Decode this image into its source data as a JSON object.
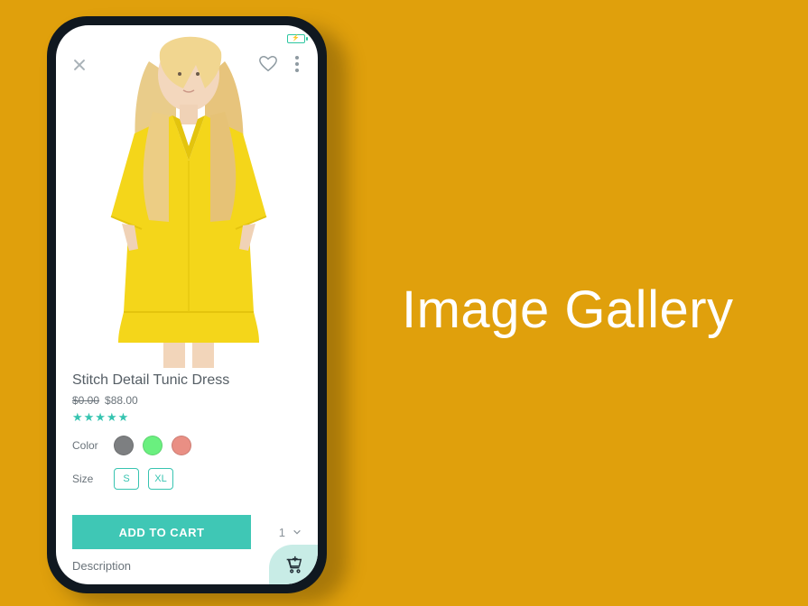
{
  "hero_title": "Image Gallery",
  "status": {
    "battery_icon": "battery-charging-icon"
  },
  "topbar": {
    "close_icon": "close-icon",
    "favorite_icon": "heart-icon",
    "more_icon": "more-vertical-icon"
  },
  "product": {
    "title": "Stitch Detail Tunic Dress",
    "price_old": "$0.00",
    "price_new": "$88.00",
    "rating_stars": "★★★★★",
    "color_label": "Color",
    "colors": [
      {
        "name": "gray",
        "hex": "#7d7f81"
      },
      {
        "name": "green",
        "hex": "#6af07f"
      },
      {
        "name": "pink",
        "hex": "#e98f84"
      }
    ],
    "size_label": "Size",
    "sizes": [
      "S",
      "XL"
    ],
    "add_to_cart_label": "ADD TO CART",
    "quantity": "1",
    "description_tab_label": "Description",
    "cart_fab_icon": "add-to-cart-icon"
  }
}
